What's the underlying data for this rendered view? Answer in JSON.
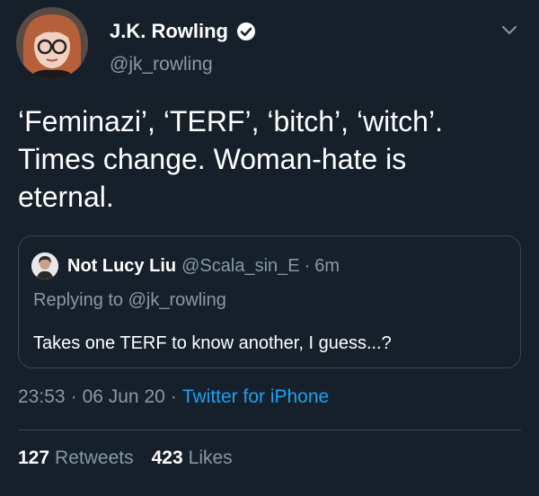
{
  "author": {
    "display_name": "J.K. Rowling",
    "handle": "@jk_rowling",
    "verified": true
  },
  "tweet": {
    "text": "‘Feminazi’, ‘TERF’, ‘bitch’, ‘witch’.\nTimes change. Woman-hate is\neternal."
  },
  "quoted_tweet": {
    "name": "Not Lucy Liu",
    "handle": "@Scala_sin_E",
    "separator": "·",
    "time": "6m",
    "replying_to": "Replying to @jk_rowling",
    "text": "Takes one TERF to know another, I guess...?"
  },
  "meta": {
    "time": "23:53",
    "separator": "·",
    "date": "06 Jun 20",
    "source": "Twitter for iPhone"
  },
  "stats": {
    "retweets_count": "127",
    "retweets_label": "Retweets",
    "likes_count": "423",
    "likes_label": "Likes"
  },
  "colors": {
    "background": "#15202b",
    "secondary_text": "#8899a6",
    "link": "#1da1f2",
    "border": "#38444d"
  }
}
